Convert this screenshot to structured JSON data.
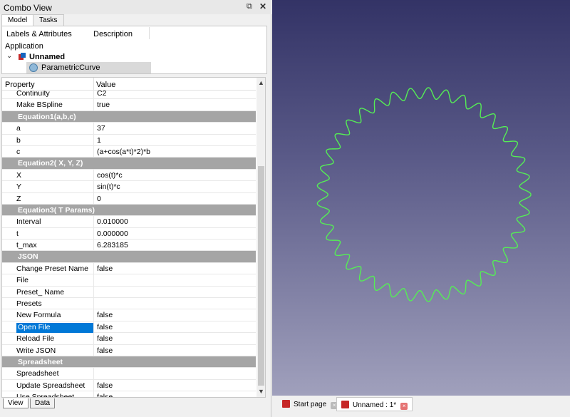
{
  "panel": {
    "title": "Combo View",
    "float_glyph": "⧉",
    "close_glyph": "✕",
    "tabs": [
      "Model",
      "Tasks"
    ]
  },
  "tree": {
    "col1": "Labels & Attributes",
    "col2": "Description",
    "application": "Application",
    "document": "Unnamed",
    "object": "ParametricCurve"
  },
  "properties": {
    "headers": [
      "Property",
      "Value"
    ],
    "rows": [
      {
        "k": "Continuity",
        "v": "C2"
      },
      {
        "k": "Make BSpline",
        "v": "true"
      },
      {
        "group": "Equation1(a,b,c)"
      },
      {
        "k": "a",
        "v": "37"
      },
      {
        "k": "b",
        "v": "1"
      },
      {
        "k": "c",
        "v": "(a+cos(a*t)*2)*b"
      },
      {
        "group": "Equation2( X, Y, Z)"
      },
      {
        "k": "X",
        "v": "cos(t)*c"
      },
      {
        "k": "Y",
        "v": "sin(t)*c"
      },
      {
        "k": "Z",
        "v": "0"
      },
      {
        "group": "Equation3( T Params)"
      },
      {
        "k": "Interval",
        "v": "0.010000"
      },
      {
        "k": "t",
        "v": "0.000000"
      },
      {
        "k": "t_max",
        "v": "6.283185"
      },
      {
        "group": "JSON"
      },
      {
        "k": "Change Preset Name",
        "v": "false"
      },
      {
        "k": "File",
        "v": ""
      },
      {
        "k": "Preset_ Name",
        "v": ""
      },
      {
        "k": "Presets",
        "v": ""
      },
      {
        "k": "New Formula",
        "v": "false"
      },
      {
        "k": "Open File",
        "v": "false",
        "selected": true
      },
      {
        "k": "Reload File",
        "v": "false"
      },
      {
        "k": "Write JSON",
        "v": "false"
      },
      {
        "group": "Spreadsheet"
      },
      {
        "k": "Spreadsheet",
        "v": ""
      },
      {
        "k": "Update Spreadsheet",
        "v": "false"
      },
      {
        "k": "Use Spreadsheet",
        "v": "false"
      }
    ]
  },
  "bottom_tabs": [
    "View",
    "Data"
  ],
  "doc_tabs": [
    {
      "label": "Start page",
      "active": false
    },
    {
      "label": "Unnamed : 1*",
      "active": true
    }
  ],
  "scroll_arrows": {
    "up": "▲",
    "down": "▼"
  },
  "tree_chevron": "⌄",
  "curve": {
    "a": 37,
    "b": 1,
    "color": "#55ee55"
  },
  "colors": {
    "selection": "#0078d7",
    "group": "#a5a5a5"
  }
}
